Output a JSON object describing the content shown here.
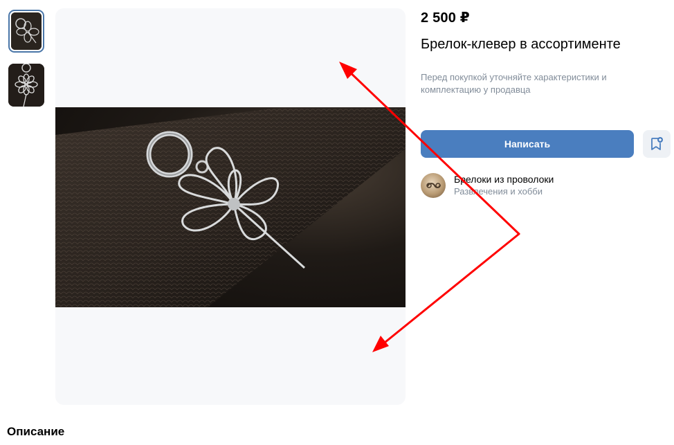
{
  "product": {
    "price": "2 500 ₽",
    "title": "Брелок-клевер в ассортименте",
    "note": "Перед покупкой уточняйте характеристики и комплектацию у продавца"
  },
  "actions": {
    "write_label": "Написать",
    "favorite_icon": "bookmark-plus-icon"
  },
  "shop": {
    "name": "Брелоки из проволоки",
    "category": "Развлечения и хобби"
  },
  "description": {
    "heading": "Описание"
  },
  "gallery": {
    "thumbnails": [
      "clover-keychain-photo",
      "flower-keychain-photo"
    ],
    "selected_index": 0
  },
  "colors": {
    "primary_button": "#4a7ebf",
    "secondary_text": "#818c99",
    "annotation_arrow": "#ff0000"
  }
}
